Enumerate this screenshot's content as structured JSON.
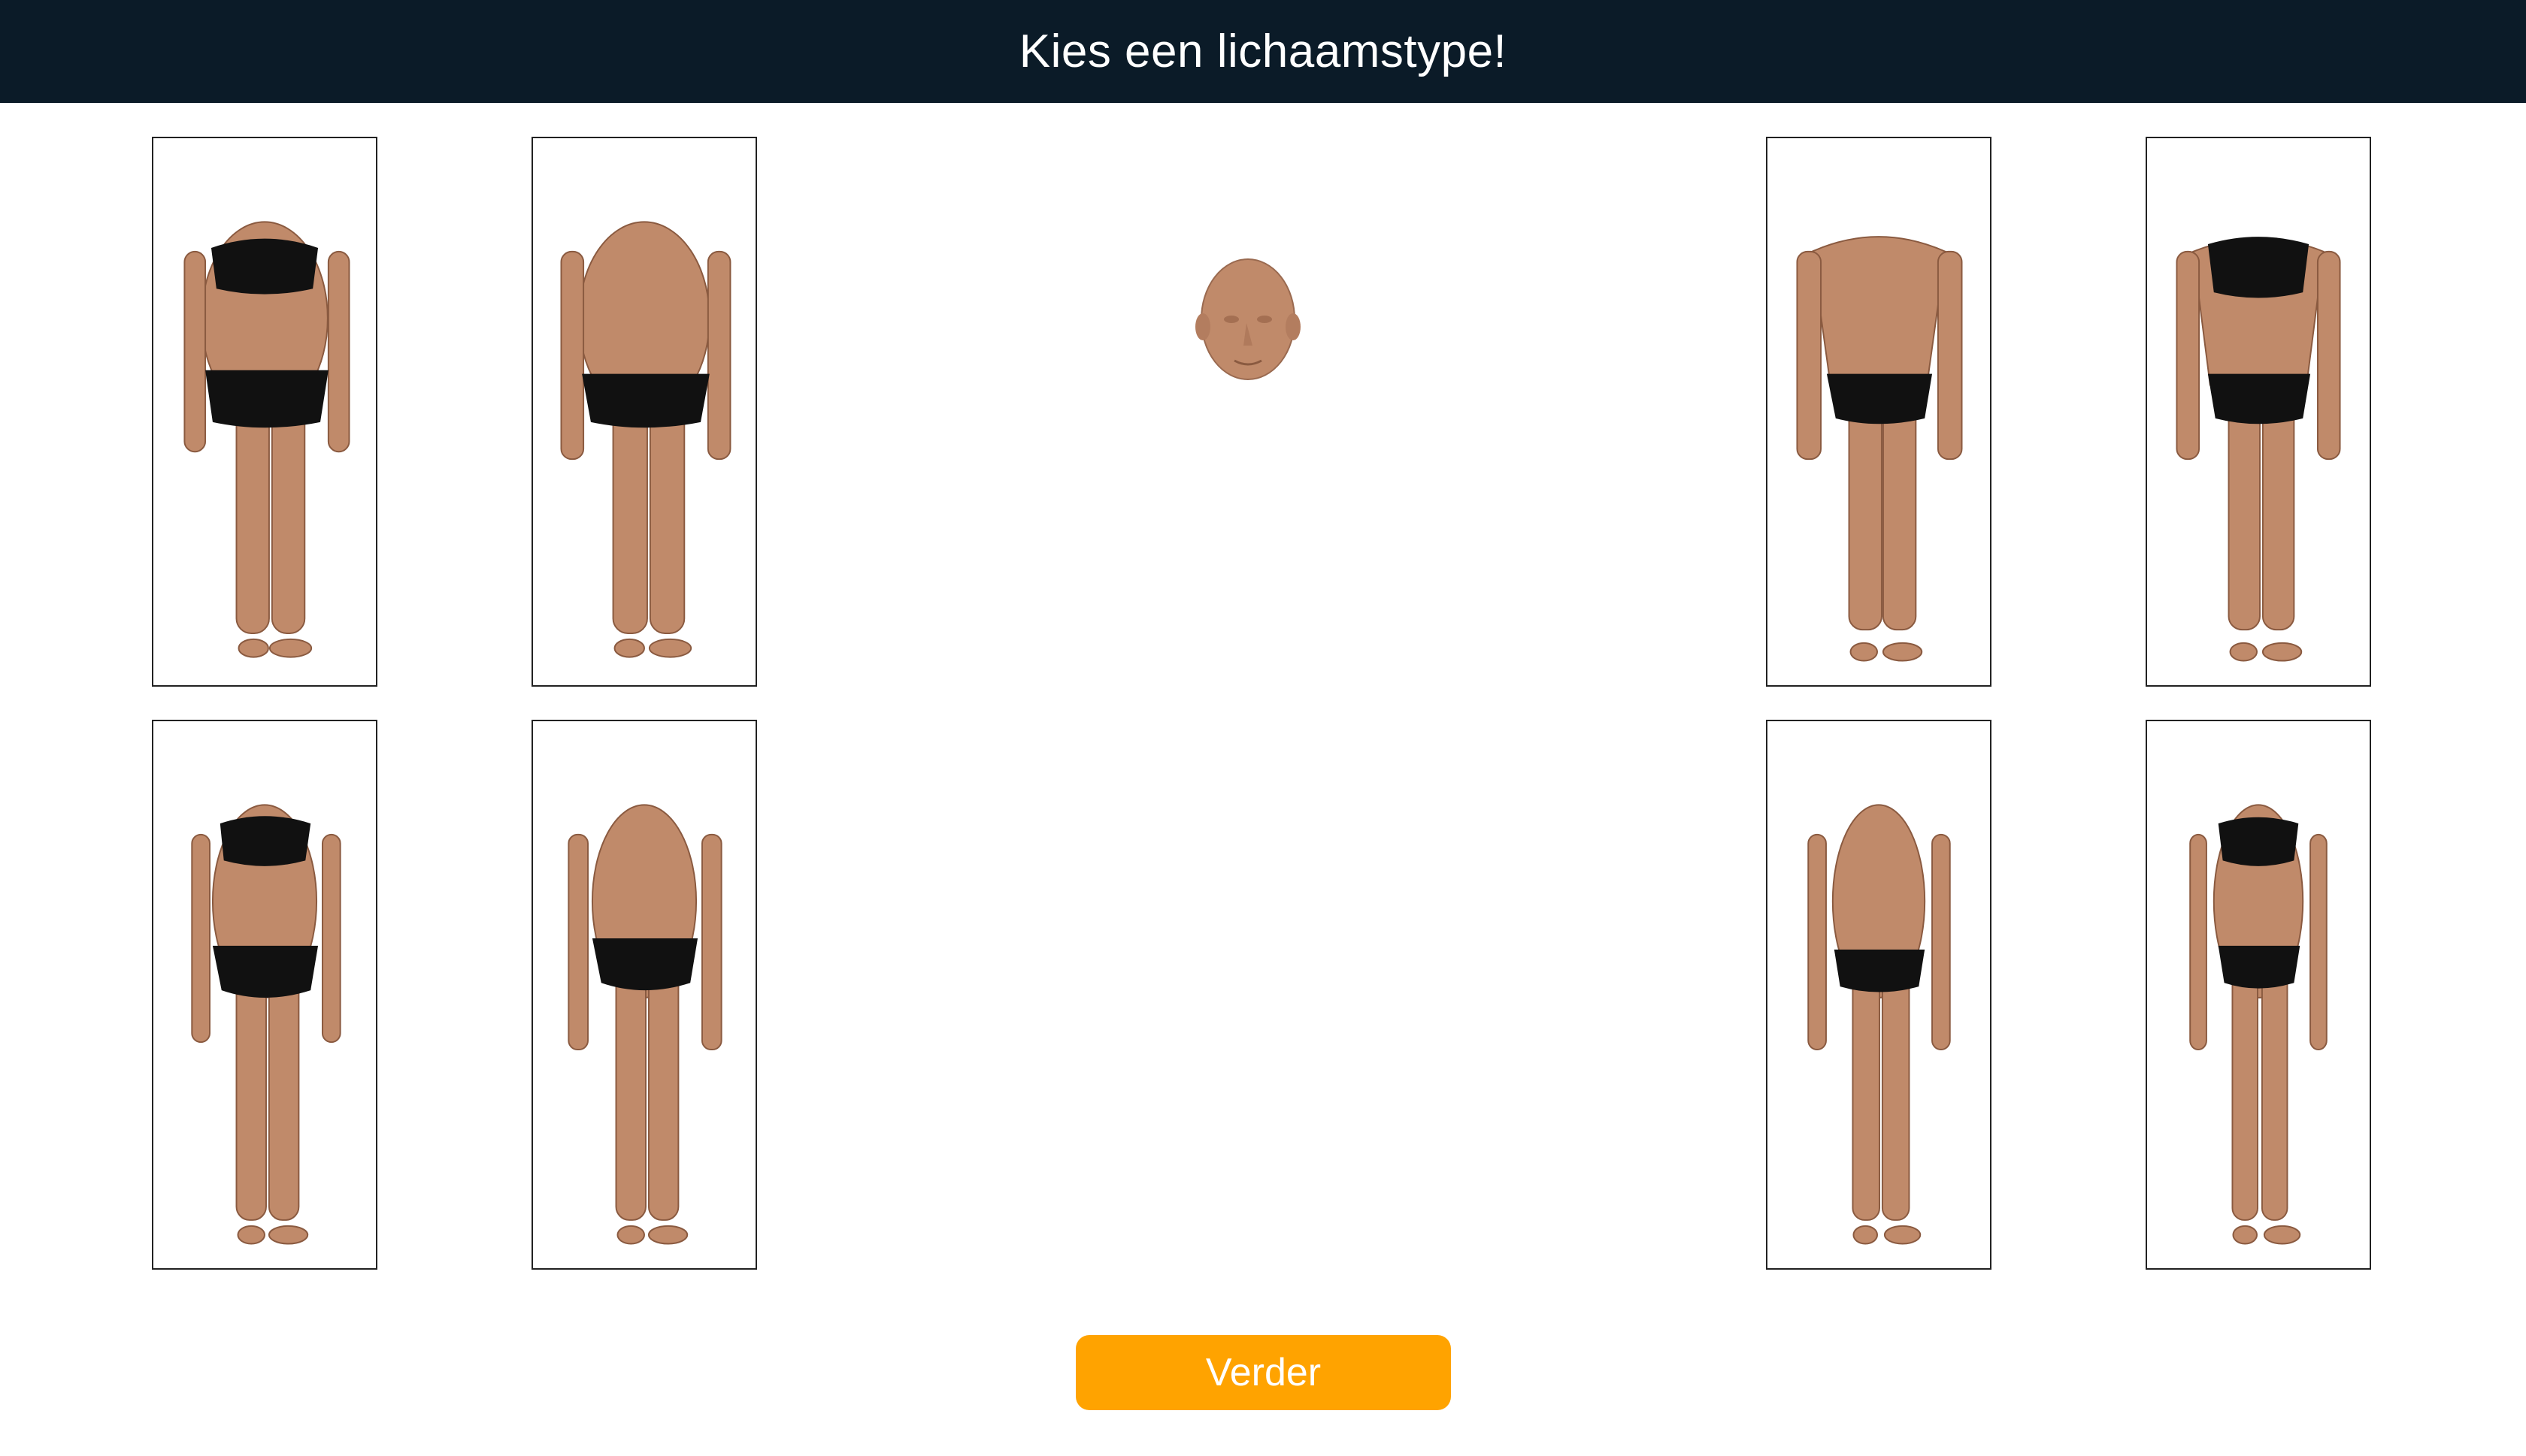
{
  "header": {
    "title": "Kies een lichaamstype!"
  },
  "body_types": [
    {
      "id": "female-heavy",
      "underwear": "bra-and-briefs",
      "build": "heavy"
    },
    {
      "id": "male-heavy",
      "underwear": "briefs",
      "build": "heavy"
    },
    {
      "id": "female-average",
      "underwear": "bra-and-briefs",
      "build": "average"
    },
    {
      "id": "male-average",
      "underwear": "briefs",
      "build": "average"
    },
    {
      "id": "male-muscular",
      "underwear": "briefs",
      "build": "muscular"
    },
    {
      "id": "female-muscular",
      "underwear": "bra-and-briefs",
      "build": "muscular"
    },
    {
      "id": "male-slim",
      "underwear": "briefs",
      "build": "slim"
    },
    {
      "id": "female-slim",
      "underwear": "bra-and-briefs",
      "build": "slim"
    }
  ],
  "preview": {
    "icon": "head-preview-icon"
  },
  "continue_button": {
    "label": "Verder"
  },
  "colors": {
    "header_bg": "#0b1b28",
    "button_bg": "#ffa300",
    "skin": "#c08a6a",
    "underwear": "#111111"
  }
}
